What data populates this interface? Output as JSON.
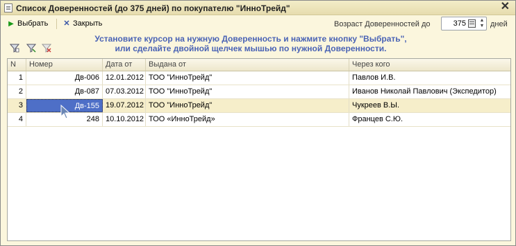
{
  "window": {
    "title": "Список Доверенностей (до 375 дней) по покупателю \"ИнноТрейд\"",
    "close_icon": "close-icon"
  },
  "toolbar": {
    "choose_label": "Выбрать",
    "close_label": "Закрыть",
    "age_label": "Возраст Доверенностей до",
    "age_value": "375",
    "days_label": "дней"
  },
  "filters": {
    "icons": [
      "filter-icon",
      "filter-edit-icon",
      "filter-clear-icon"
    ]
  },
  "hint": {
    "line1": "Установите курсор на нужную Доверенность и нажмите кнопку \"Выбрать\",",
    "line2": "или сделайте двойной щелчек мышью по нужной Доверенности."
  },
  "table": {
    "columns": [
      "N",
      "Номер",
      "Дата от",
      "Выдана от",
      "Через кого"
    ],
    "rows": [
      {
        "n": "1",
        "number": "Дв-006",
        "date": "12.01.2012",
        "issued_by": "ТОО \"ИнноТрейд\"",
        "through": "Павлов И.В."
      },
      {
        "n": "2",
        "number": "Дв-087",
        "date": "07.03.2012",
        "issued_by": "ТОО \"ИнноТрейд\"",
        "through": "Иванов Николай Павлович (Экспедитор)"
      },
      {
        "n": "3",
        "number": "Дв-155",
        "date": "19.07.2012",
        "issued_by": "ТОО \"ИнноТрейд\"",
        "through": "Чукреев В.Ы."
      },
      {
        "n": "4",
        "number": "248",
        "date": "10.10.2012",
        "issued_by": "ТОО «ИнноТрейд»",
        "through": "Францев С.Ю."
      }
    ]
  },
  "colors": {
    "hint": "#4a63b5",
    "selection": "#4e6fc7",
    "window_bg": "#fbf6dd"
  }
}
